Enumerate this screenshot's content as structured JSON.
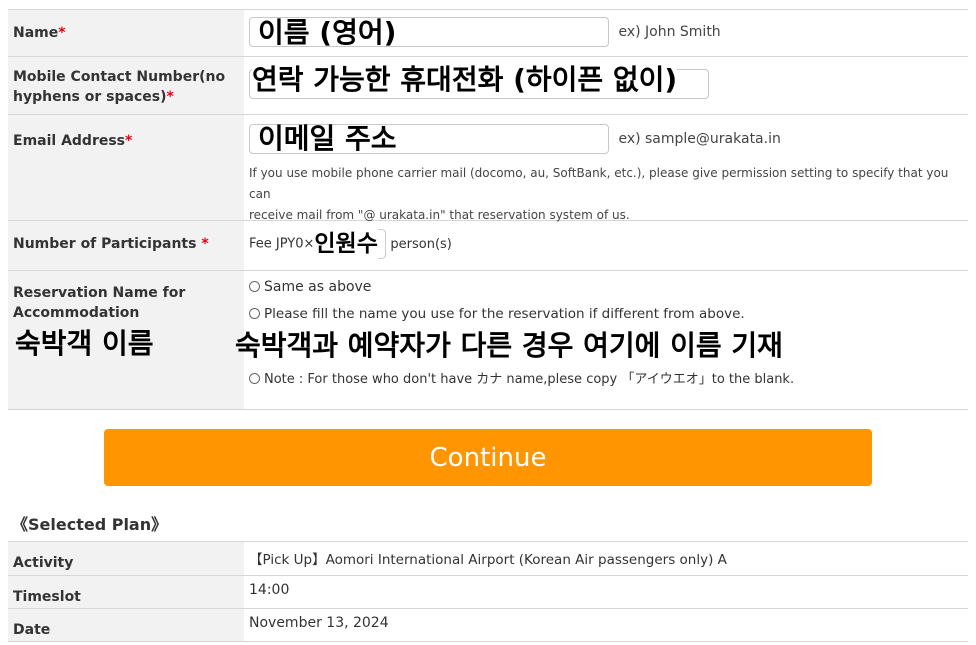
{
  "form": {
    "name": {
      "label": "Name",
      "required": "*",
      "overlay": "이름 (영어)",
      "example": "ex) John Smith"
    },
    "mobile": {
      "label_line1": "Mobile Contact Number(no",
      "label_line2": "hyphens or spaces)",
      "required": "*",
      "overlay": "연락 가능한 휴대전화 (하이픈 없이)"
    },
    "email": {
      "label": "Email Address",
      "required": "*",
      "overlay": "이메일 주소",
      "example": "ex) sample@urakata.in",
      "note_line1": "If you use mobile phone carrier mail (docomo, au, SoftBank, etc.), please give permission setting to specify that you can",
      "note_line2": "receive mail from \"@ urakata.in\" that reservation system of us."
    },
    "participants": {
      "label": "Number of Participants",
      "required": "*",
      "fee": "Fee JPY0×",
      "overlay": "인원수",
      "unit": "person(s)"
    },
    "accommodation": {
      "label_line1": "Reservation Name for",
      "label_line2": "Accommodation",
      "label_overlay": "숙박객 이름",
      "option1": "Same as above",
      "option2": "Please fill the name you use for the reservation if different from above.",
      "overlay": "숙박객과 예약자가 다른 경우 여기에 이름 기재",
      "option3": "Note : For those who don't have カナ name,plese copy 「アイウエオ」to the blank."
    }
  },
  "continue_label": "Continue",
  "selected_plan": {
    "title": "《Selected Plan》",
    "rows": [
      {
        "label": "Activity",
        "value": "【Pick Up】Aomori International Airport (Korean Air passengers only) A"
      },
      {
        "label": "Timeslot",
        "value": "14:00"
      },
      {
        "label": "Date",
        "value": "November 13, 2024"
      }
    ]
  },
  "colors": {
    "accent": "#ff9500",
    "required": "#e60012",
    "label_bg": "#f2f2f2"
  }
}
